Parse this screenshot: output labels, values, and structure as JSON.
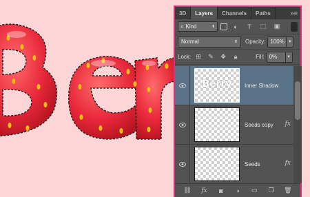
{
  "canvas": {
    "text": "Berry",
    "background_color": "#fcd6d6",
    "text_color": "#e8273a",
    "seed_color": "#f2b81e"
  },
  "panel": {
    "tabs": [
      {
        "label": "3D",
        "active": false
      },
      {
        "label": "Layers",
        "active": true
      },
      {
        "label": "Channels",
        "active": false
      },
      {
        "label": "Paths",
        "active": false
      }
    ],
    "menu_icon": "panel-menu-icon",
    "filter": {
      "kind_label": "Kind"
    },
    "blend_mode": "Normal",
    "opacity_label": "Opacity:",
    "opacity_value": "100%",
    "lock_label": "Lock:",
    "fill_label": "Fill:",
    "fill_value": "0%",
    "layers": [
      {
        "name": "Inner Shadow",
        "selected": true,
        "thumb_text": "Berry",
        "has_fx": false
      },
      {
        "name": "Seeds copy",
        "selected": false,
        "thumb_text": "",
        "has_fx": true
      },
      {
        "name": "Seeds",
        "selected": false,
        "thumb_text": "",
        "has_fx": true
      }
    ],
    "fx_label": "fx",
    "footer_icons": [
      "link-icon",
      "fx-icon",
      "mask-icon",
      "adjustment-icon",
      "group-folder-icon",
      "new-layer-icon",
      "trash-icon"
    ],
    "accent_border": "#d8337a",
    "selected_row_color": "#5b7389"
  }
}
